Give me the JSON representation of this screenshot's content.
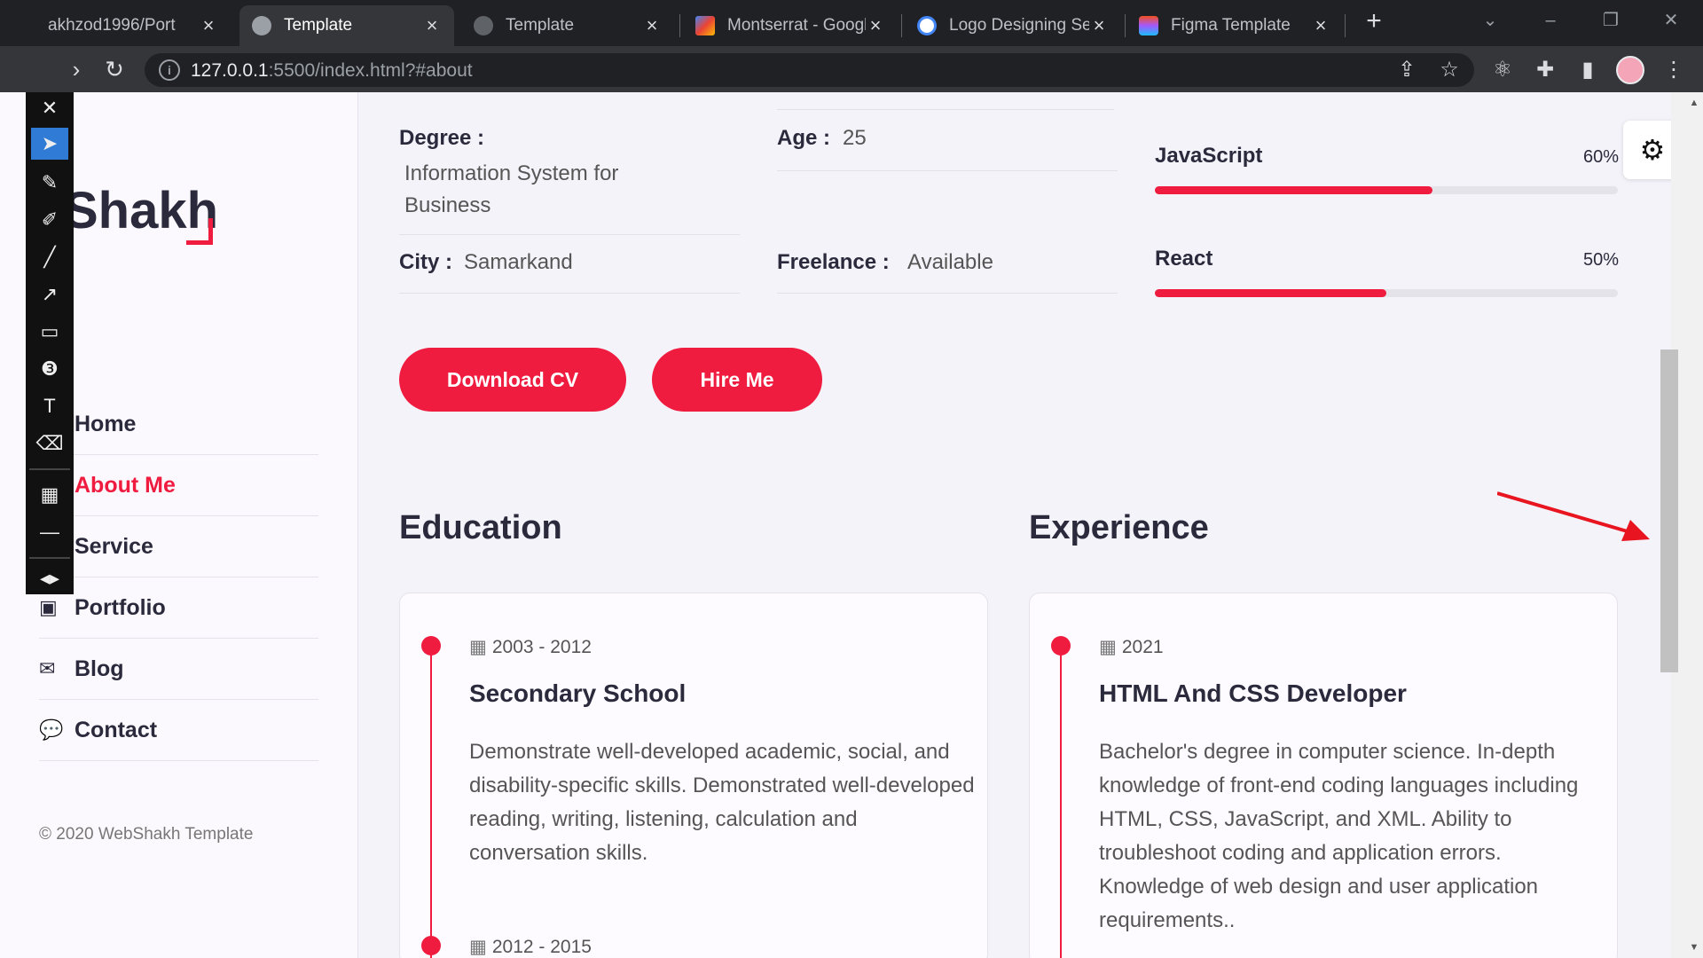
{
  "browser": {
    "tabs": [
      {
        "title": "akhzod1996/Port",
        "active": false
      },
      {
        "title": "Template",
        "active": true
      },
      {
        "title": "Template",
        "active": false
      },
      {
        "title": "Montserrat - Googl",
        "active": false
      },
      {
        "title": "Logo Designing Ser",
        "active": false
      },
      {
        "title": "Figma Template",
        "active": false
      }
    ],
    "url_host": "127.0.0.1",
    "url_rest": ":5500/index.html?#about"
  },
  "sidebar": {
    "logo": "Shakh",
    "nav": [
      {
        "label": "Home",
        "icon": "home-icon",
        "active": false
      },
      {
        "label": "About Me",
        "icon": "user-icon",
        "active": true
      },
      {
        "label": "Service",
        "icon": "list-icon",
        "active": false
      },
      {
        "label": "Portfolio",
        "icon": "briefcase-icon",
        "active": false
      },
      {
        "label": "Blog",
        "icon": "envelope-icon",
        "active": false
      },
      {
        "label": "Contact",
        "icon": "comments-icon",
        "active": false
      }
    ],
    "copyright": "© 2020 WebShakh Template"
  },
  "about": {
    "degree_label": "Degree :",
    "degree_value": "Information System for Business",
    "age_label": "Age :",
    "age_value": "25",
    "city_label": "City :",
    "city_value": "Samarkand",
    "freelance_label": "Freelance :",
    "freelance_value": "Available"
  },
  "skills": [
    {
      "name": "JavaScript",
      "percent_label": "60%",
      "percent": 60
    },
    {
      "name": "React",
      "percent_label": "50%",
      "percent": 50
    }
  ],
  "buttons": {
    "download_cv": "Download CV",
    "hire_me": "Hire Me"
  },
  "education": {
    "title": "Education",
    "items": [
      {
        "date": "2003 - 2012",
        "title": "Secondary School",
        "description": "Demonstrate well-developed academic, social, and disability-specific skills. Demonstrated well-developed reading, writing, listening, calculation and conversation skills."
      },
      {
        "date": "2012 - 2015",
        "title": "",
        "description": ""
      }
    ]
  },
  "experience": {
    "title": "Experience",
    "items": [
      {
        "date": "2021",
        "title": "HTML And CSS Developer",
        "description": "Bachelor's degree in computer science. In-depth knowledge of front-end coding languages including HTML, CSS, JavaScript, and XML. Ability to troubleshoot coding and application errors. Knowledge of web design and user application requirements.."
      }
    ]
  },
  "colors": {
    "accent": "#ef1c3f",
    "text_dark": "#2b2a3c",
    "page_bg": "#f4f3fa"
  }
}
